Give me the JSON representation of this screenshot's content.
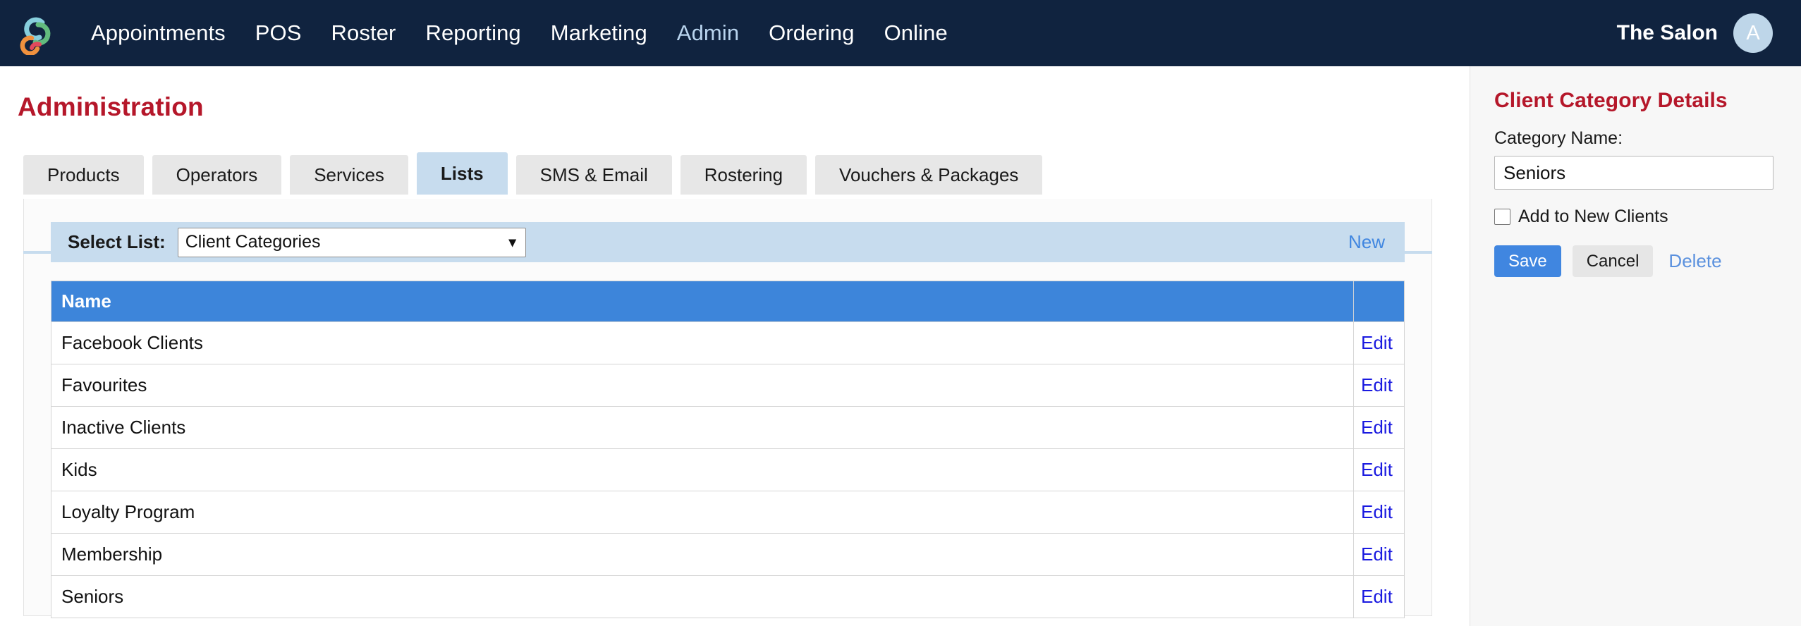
{
  "topnav": {
    "logo_name": "salon-logo",
    "links": [
      {
        "label": "Appointments",
        "active": false
      },
      {
        "label": "POS",
        "active": false
      },
      {
        "label": "Roster",
        "active": false
      },
      {
        "label": "Reporting",
        "active": false
      },
      {
        "label": "Marketing",
        "active": false
      },
      {
        "label": "Admin",
        "active": true
      },
      {
        "label": "Ordering",
        "active": false
      },
      {
        "label": "Online",
        "active": false
      }
    ],
    "salon_name": "The Salon",
    "avatar_initial": "A"
  },
  "page": {
    "title": "Administration"
  },
  "tabs": [
    {
      "label": "Products",
      "active": false
    },
    {
      "label": "Operators",
      "active": false
    },
    {
      "label": "Services",
      "active": false
    },
    {
      "label": "Lists",
      "active": true
    },
    {
      "label": "SMS & Email",
      "active": false
    },
    {
      "label": "Rostering",
      "active": false
    },
    {
      "label": "Vouchers & Packages",
      "active": false
    }
  ],
  "select_bar": {
    "label": "Select List:",
    "selected": "Client Categories",
    "options": [
      "Client Categories"
    ],
    "caret_icon": "chevron-down-icon",
    "new_label": "New"
  },
  "table": {
    "columns": [
      "Name",
      ""
    ],
    "action_label": "Edit",
    "rows": [
      {
        "name": "Facebook Clients",
        "action": "Edit"
      },
      {
        "name": "Favourites",
        "action": "Edit"
      },
      {
        "name": "Inactive Clients",
        "action": "Edit"
      },
      {
        "name": "Kids",
        "action": "Edit"
      },
      {
        "name": "Loyalty Program",
        "action": "Edit"
      },
      {
        "name": "Membership",
        "action": "Edit"
      },
      {
        "name": "Seniors",
        "action": "Edit"
      }
    ]
  },
  "details_panel": {
    "title": "Client Category Details",
    "category_name_label": "Category Name:",
    "category_name_value": "Seniors",
    "category_name_placeholder": "",
    "checkbox_label": "Add to New Clients",
    "checkbox_checked": false,
    "save_label": "Save",
    "cancel_label": "Cancel",
    "delete_label": "Delete"
  },
  "colors": {
    "nav_bg": "#10233f",
    "heading_red": "#b5172a",
    "accent_blue": "#4086e0",
    "table_header_blue": "#3d85da",
    "active_tab_blue": "#c7dcee",
    "edit_link_blue": "#1a1ae0",
    "panel_bg": "#f7f7f7"
  }
}
